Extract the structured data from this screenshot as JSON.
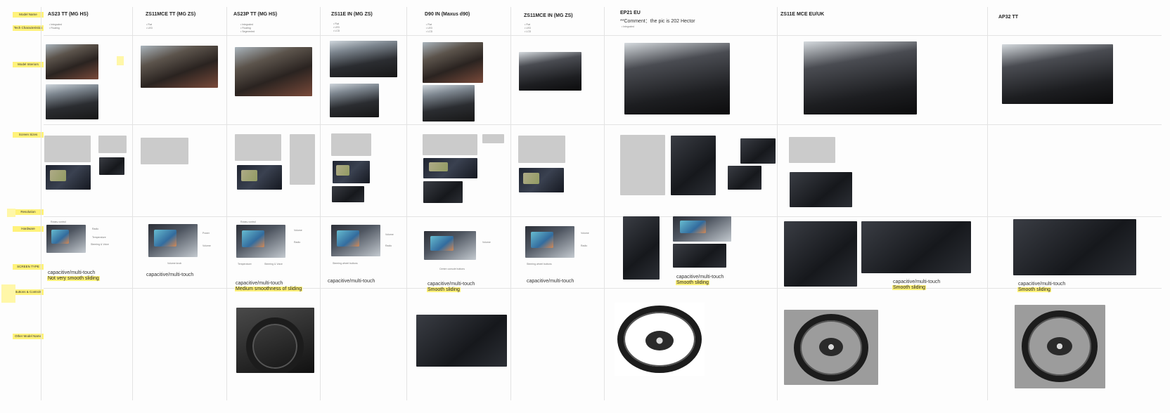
{
  "row_labels": [
    "Model Name",
    "Tech Characteristics",
    "Model Interiors",
    "Screen Sizes",
    "Resolution",
    "Hardware",
    "SCREEN TYPE",
    "Buttons & Controls",
    "Other Model Name"
  ],
  "models": [
    {
      "title": "AS23 TT (MG HS)",
      "tech": [
        "Integrated",
        "Floating"
      ],
      "caption": "capacitive/multi-touch",
      "note": "Not very smooth sliding"
    },
    {
      "title": "ZS11MCE TT (MG ZS)",
      "tech": [
        "Flat",
        "LED"
      ],
      "caption": "capacitive/multi-touch",
      "note": ""
    },
    {
      "title": "AS23P TT (MG HS)",
      "tech": [
        "Integrated",
        "Floating",
        "Segmented"
      ],
      "caption": "capacitive/multi-touch",
      "note": "Medium smoothness of sliding"
    },
    {
      "title": "ZS11E IN (MG ZS)",
      "tech": [
        "Flat",
        "LED",
        "LCD"
      ],
      "caption": "capacitive/multi-touch",
      "note": ""
    },
    {
      "title": "D90 IN (Maxus d90)",
      "tech": [
        "Flat",
        "LED",
        "LCD"
      ],
      "caption": "capacitive/multi-touch",
      "note": "Smooth sliding"
    },
    {
      "title": "ZS11MCE IN (MG ZS)",
      "tech": [
        "Flat",
        "LED",
        "LCD"
      ],
      "caption": "capacitive/multi-touch",
      "note": ""
    },
    {
      "title": "EP21 EU",
      "comment": "**Comment：the pic is 202 Hector",
      "tech": [
        "Integrated"
      ],
      "caption": "capacitive/multi-touch",
      "note": "Smooth sliding"
    },
    {
      "title": "ZS11E MCE EU/UK",
      "tech": [],
      "caption": "capacitive/multi-touch",
      "note": "Smooth sliding"
    },
    {
      "title": "AP32 TT",
      "tech": [],
      "caption": "capacitive/multi-touch",
      "note": "Smooth sliding"
    }
  ],
  "hardware_labels": {
    "as23": [
      "Rotary control",
      "Radio",
      "Temperature",
      "Steering & Voice"
    ],
    "zs11mce": [
      "Power",
      "Volume",
      "Volume knob"
    ],
    "as23p": [
      "Rotary control",
      "Volume",
      "Radio",
      "Temperature",
      "Steering & Voice"
    ],
    "zs11e": [
      "Steering wheel buttons",
      "Volume",
      "Radio"
    ],
    "d90": [
      "Volume",
      "Centre console buttons"
    ],
    "zs11mce_in": [
      "Steering wheel buttons",
      "Volume",
      "Radio"
    ]
  },
  "colors": {
    "highlight": "#fff27a",
    "grid": "#e3e3e3",
    "sticky": "#fff7a8"
  }
}
